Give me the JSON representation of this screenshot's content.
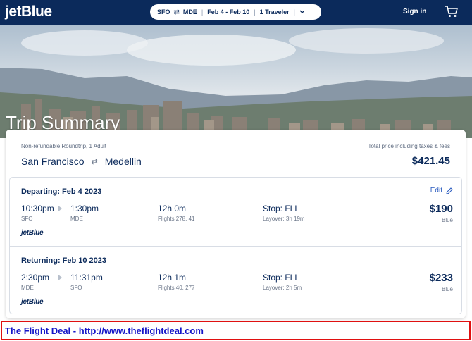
{
  "nav": {
    "logo": "jetBlue",
    "search": {
      "origin": "SFO",
      "destination": "MDE",
      "dates": "Feb 4 - Feb 10",
      "travelers": "1 Traveler"
    },
    "signin": "Sign in",
    "cart_icon": "cart-icon"
  },
  "hero": {
    "title": "Trip Summary"
  },
  "summary": {
    "fare_type": "Non-refundable Roundtrip, 1 Adult",
    "origin_city": "San Francisco",
    "destination_city": "Medellin",
    "total_label": "Total price including taxes & fees",
    "total_price": "$421.45"
  },
  "departing": {
    "title": "Departing: Feb 4 2023",
    "edit_label": "Edit",
    "depart_time": "10:30pm",
    "depart_airport": "SFO",
    "arrive_time": "1:30pm",
    "arrive_airport": "MDE",
    "duration": "12h 0m",
    "flights": "Flights 278, 41",
    "stop": "Stop: FLL",
    "layover": "Layover: 3h 19m",
    "price": "$190",
    "fare": "Blue",
    "carrier": "jetBlue"
  },
  "returning": {
    "title": "Returning: Feb 10 2023",
    "depart_time": "2:30pm",
    "depart_airport": "MDE",
    "arrive_time": "11:31pm",
    "arrive_airport": "SFO",
    "duration": "12h 1m",
    "flights": "Flights 40, 277",
    "stop": "Stop: FLL",
    "layover": "Layover: 2h 5m",
    "price": "$233",
    "fare": "Blue",
    "carrier": "jetBlue"
  },
  "banner": {
    "text": "The Flight Deal - http://www.theflightdeal.com"
  },
  "colors": {
    "navy": "#0b2a5b",
    "link": "#2a5bbf",
    "banner_border": "#e01010",
    "banner_text": "#1414c8"
  }
}
